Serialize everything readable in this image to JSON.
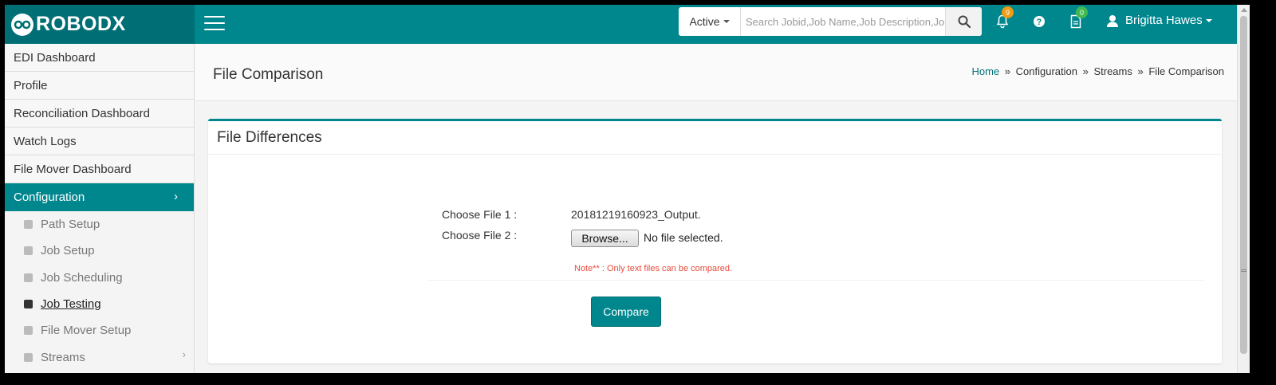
{
  "brand": {
    "name": "ROBODX"
  },
  "topbar": {
    "status_filter": "Active",
    "search_placeholder": "Search Jobid,Job Name,Job Description,Job",
    "notifications_count": "9",
    "tasks_count": "0",
    "user_name": "Brigitta Hawes"
  },
  "sidebar": {
    "items": [
      {
        "label": "EDI Dashboard"
      },
      {
        "label": "Profile"
      },
      {
        "label": "Reconciliation Dashboard"
      },
      {
        "label": "Watch Logs"
      },
      {
        "label": "File Mover Dashboard"
      },
      {
        "label": "Configuration"
      }
    ],
    "sub_items": [
      {
        "label": "Path Setup"
      },
      {
        "label": "Job Setup"
      },
      {
        "label": "Job Scheduling"
      },
      {
        "label": "Job Testing"
      },
      {
        "label": "File Mover Setup"
      },
      {
        "label": "Streams"
      }
    ]
  },
  "page": {
    "title": "File Comparison",
    "breadcrumb": [
      "Home",
      "Configuration",
      "Streams",
      "File Comparison"
    ],
    "breadcrumb_sep": "»"
  },
  "panel": {
    "title": "File Differences",
    "file1_label": "Choose File 1 :",
    "file1_value": "20181219160923_Output.",
    "file2_label": "Choose File 2 :",
    "browse_label": "Browse...",
    "no_file_text": "No file selected.",
    "note": "Note** : Only text files can be compared.",
    "compare_label": "Compare"
  },
  "colors": {
    "primary": "#00878e",
    "primary_dark": "#006f75",
    "note_red": "#e74c3c",
    "badge_orange": "#f39c12",
    "badge_green": "#3fb950"
  }
}
